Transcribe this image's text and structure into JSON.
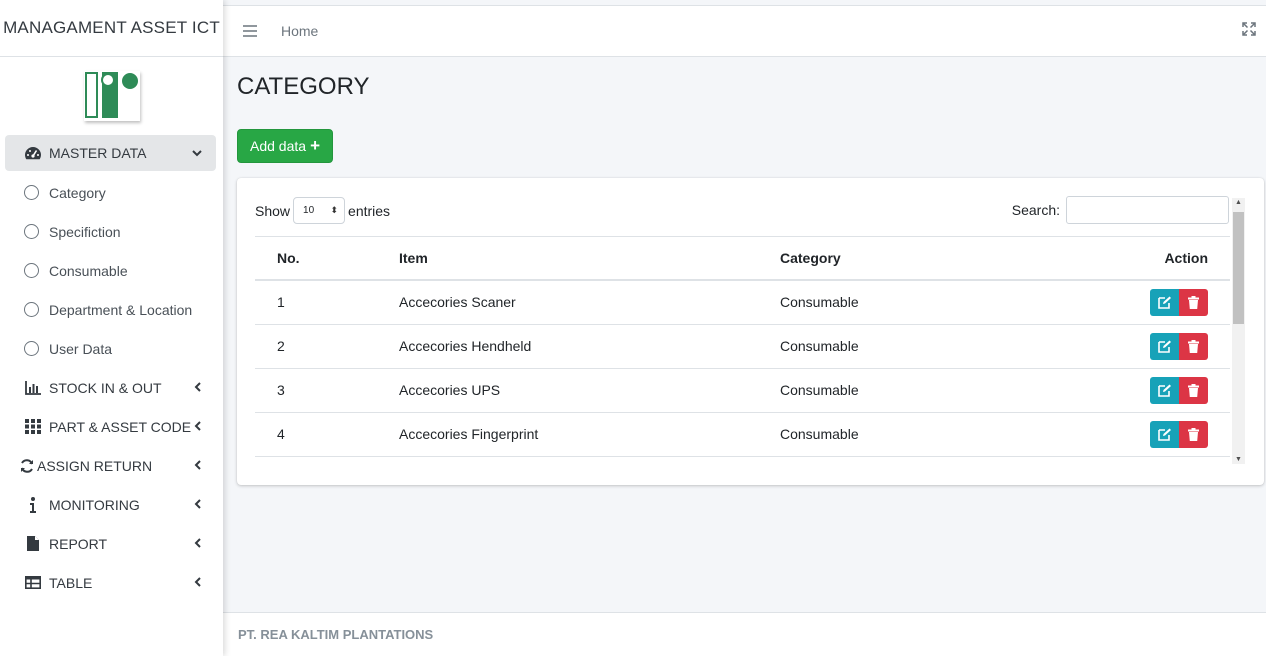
{
  "sidebar": {
    "brand": "MANAGAMENT ASSET ICT",
    "menu": [
      {
        "label": "MASTER DATA",
        "icon": "tachometer-icon",
        "arrow": "chevron-down"
      },
      {
        "label": "STOCK IN & OUT",
        "icon": "bar-chart-icon",
        "arrow": "chevron-left"
      },
      {
        "label": "PART & ASSET CODE",
        "icon": "grid-icon",
        "arrow": "chevron-left"
      },
      {
        "label": "ASSIGN RETURN",
        "icon": "refresh-icon",
        "arrow": "chevron-left"
      },
      {
        "label": "MONITORING",
        "icon": "info-icon",
        "arrow": "chevron-left"
      },
      {
        "label": "REPORT",
        "icon": "file-icon",
        "arrow": "chevron-left"
      },
      {
        "label": "TABLE",
        "icon": "table-icon",
        "arrow": "chevron-left"
      }
    ],
    "submenu": [
      "Category",
      "Specifiction",
      "Consumable",
      "Department & Location",
      "User Data"
    ]
  },
  "topbar": {
    "breadcrumb": "Home"
  },
  "page": {
    "title": "CATEGORY",
    "add_button": "Add data"
  },
  "table_controls": {
    "show_label": "Show",
    "entries_value": "10",
    "entries_label": "entries",
    "search_label": "Search:"
  },
  "table": {
    "headers": [
      "No.",
      "Item",
      "Category",
      "Action"
    ],
    "rows": [
      {
        "no": "1",
        "item": "Accecories Scaner",
        "category": "Consumable"
      },
      {
        "no": "2",
        "item": "Accecories Hendheld",
        "category": "Consumable"
      },
      {
        "no": "3",
        "item": "Accecories UPS",
        "category": "Consumable"
      },
      {
        "no": "4",
        "item": "Accecories Fingerprint",
        "category": "Consumable"
      }
    ]
  },
  "footer": {
    "text": "PT. REA KALTIM PLANTATIONS"
  },
  "colors": {
    "primary_green": "#28a745",
    "edit": "#17a2b8",
    "delete": "#dc3545",
    "logo_green": "#2e8b57"
  }
}
